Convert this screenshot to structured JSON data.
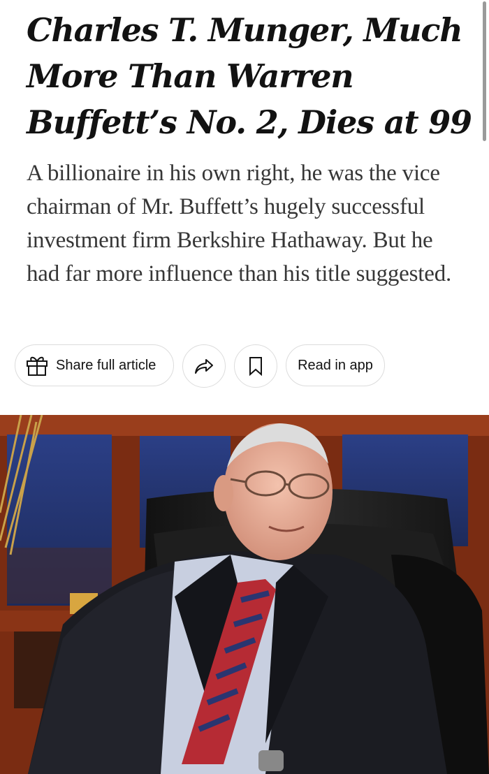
{
  "article": {
    "headline": "Charles T. Munger, Much More Than Warren Buffett’s No. 2, Dies at 99",
    "summary": "A billionaire in his own right, he was the vice chairman of Mr. Buffett’s hugely successful investment firm Berkshire Hathaway. But he had far more influence than his title suggested."
  },
  "actions": {
    "share_full_article": "Share full article",
    "read_in_app": "Read in app",
    "share_icon": "share-arrow-icon",
    "gift_icon": "gift-icon",
    "bookmark_icon": "bookmark-icon"
  },
  "colors": {
    "text": "#121212",
    "summary_text": "#363636",
    "pill_border": "#dcdcdc"
  }
}
